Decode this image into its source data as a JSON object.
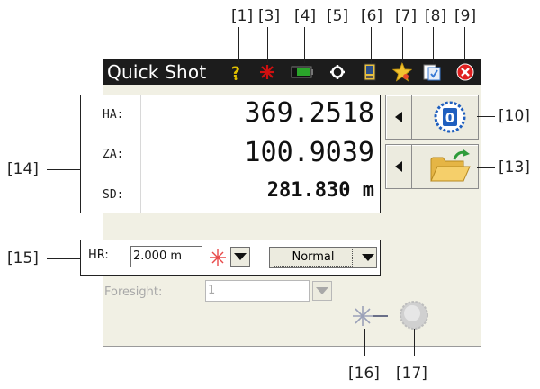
{
  "window": {
    "title": "Quick Shot"
  },
  "callouts": {
    "c1": "[1]",
    "c3": "[3]",
    "c4": "[4]",
    "c5": "[5]",
    "c6": "[6]",
    "c7": "[7]",
    "c8": "[8]",
    "c9": "[9]",
    "c10": "[10]",
    "c13": "[13]",
    "c14": "[14]",
    "c15": "[15]",
    "c16": "[16]",
    "c17": "[17]"
  },
  "titlebar_icons": [
    {
      "name": "help-icon",
      "color": "#e0c000"
    },
    {
      "name": "laser-icon",
      "color": "#d01010"
    },
    {
      "name": "battery-icon",
      "color": "#2aa52a"
    },
    {
      "name": "settings-icon",
      "color": "#ffffff"
    },
    {
      "name": "instrument-icon",
      "color": "#e8c040"
    },
    {
      "name": "favorites-icon",
      "color": "#f2c230"
    },
    {
      "name": "task-list-icon",
      "color": "#3a7bd5"
    },
    {
      "name": "close-icon",
      "color": "#e02020"
    }
  ],
  "measurements": [
    {
      "label": "HA:",
      "value": "369.2518"
    },
    {
      "label": "ZA:",
      "value": "100.9039"
    },
    {
      "label": "SD:",
      "value": "281.830 m"
    }
  ],
  "side_buttons": {
    "zero_button_digit": "0",
    "zero_icon": "reset-angle-icon",
    "folder_icon": "open-folder-icon"
  },
  "hr_row": {
    "label": "HR:",
    "value": "2.000 m",
    "target_icon": "target-type-icon",
    "mode": "Normal"
  },
  "foresight": {
    "label": "Foresight:",
    "value": "1"
  },
  "bottom_icons": {
    "laser_pointer": "laser-pointer-icon",
    "prism": "prism-icon"
  },
  "colors": {
    "titlebar_bg": "#1c1c1c",
    "screen_bg": "#f1f0e4",
    "accent_blue": "#1f5fbf"
  }
}
